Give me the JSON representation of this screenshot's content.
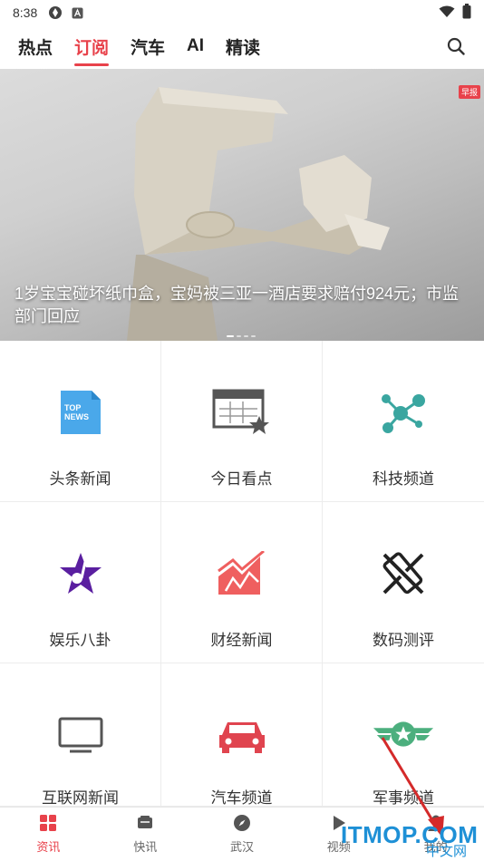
{
  "status": {
    "time": "8:38"
  },
  "topnav": {
    "tabs": [
      "热点",
      "订阅",
      "汽车",
      "AI",
      "精读"
    ],
    "active_tab": "订阅"
  },
  "banner": {
    "tag": "早报",
    "title": "1岁宝宝碰坏纸巾盒，宝妈被三亚一酒店要求赔付924元；市监部门回应"
  },
  "grid": [
    {
      "label": "头条新闻",
      "icon": "top-news-icon"
    },
    {
      "label": "今日看点",
      "icon": "calendar-star-icon"
    },
    {
      "label": "科技频道",
      "icon": "molecule-icon"
    },
    {
      "label": "娱乐八卦",
      "icon": "music-star-icon"
    },
    {
      "label": "财经新闻",
      "icon": "trend-chart-icon"
    },
    {
      "label": "数码测评",
      "icon": "phone-tools-icon"
    },
    {
      "label": "互联网新闻",
      "icon": "monitor-icon"
    },
    {
      "label": "汽车频道",
      "icon": "car-icon"
    },
    {
      "label": "军事频道",
      "icon": "military-badge-icon"
    }
  ],
  "bottombar": {
    "items": [
      "资讯",
      "快讯",
      "武汉",
      "视频",
      "我的"
    ],
    "active": "资讯"
  },
  "watermark": {
    "main": "ITMOP.COM",
    "sub": "中文网"
  },
  "colors": {
    "accent": "#e8424b"
  }
}
